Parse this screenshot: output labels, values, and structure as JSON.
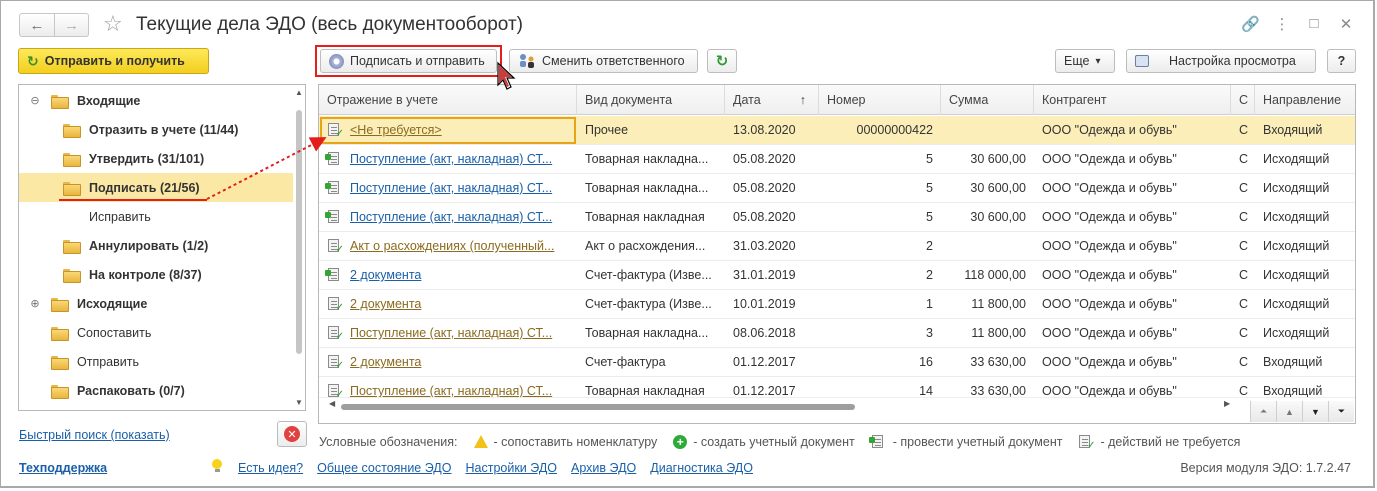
{
  "window": {
    "title": "Текущие дела ЭДО (весь документооборот)",
    "nav_back": "←",
    "nav_forward": "→",
    "star": "☆",
    "link_icon": "🔗",
    "menu_icon": "⋮",
    "maximize_icon": "□",
    "close_icon": "✕"
  },
  "left": {
    "send_button": "Отправить и получить",
    "tree": [
      {
        "label": "Входящие",
        "bold": true,
        "level": 0,
        "expander": "⊖",
        "folder": true
      },
      {
        "label": "Отразить в учете (11/44)",
        "bold": true,
        "level": 1,
        "folder": true
      },
      {
        "label": "Утвердить (31/101)",
        "bold": true,
        "level": 1,
        "folder": true
      },
      {
        "label": "Подписать (21/56)",
        "bold": true,
        "level": 1,
        "folder": true,
        "selected": true
      },
      {
        "label": "Исправить",
        "bold": false,
        "level": 1,
        "folder": false
      },
      {
        "label": "Аннулировать (1/2)",
        "bold": true,
        "level": 1,
        "folder": true
      },
      {
        "label": "На контроле (8/37)",
        "bold": true,
        "level": 1,
        "folder": true
      },
      {
        "label": "Исходящие",
        "bold": true,
        "level": 0,
        "expander": "⊕",
        "folder": true
      },
      {
        "label": "Сопоставить",
        "bold": false,
        "level": 0,
        "folder": true
      },
      {
        "label": "Отправить",
        "bold": false,
        "level": 0,
        "folder": true
      },
      {
        "label": "Распаковать (0/7)",
        "bold": true,
        "level": 0,
        "folder": true
      }
    ],
    "quick_search": "Быстрый поиск (показать)"
  },
  "toolbar": {
    "sign_send": "Подписать и отправить",
    "change_responsible": "Сменить ответственного",
    "refresh_icon": "↻",
    "more": "Еще",
    "more_arrow": "▾",
    "view_settings": "Настройка просмотра",
    "help": "?"
  },
  "table": {
    "columns": [
      "Отражение в учете",
      "Вид документа",
      "Дата",
      "Номер",
      "Сумма",
      "Контрагент",
      "С",
      "Направление"
    ],
    "sort_indicator": "↑",
    "rows": [
      {
        "account": "<Не требуется>",
        "link": "brown",
        "icon": "none",
        "doc": "Прочее",
        "date": "13.08.2020",
        "num": "00000000422",
        "sum": "",
        "party": "ООО \"Одежда и обувь\"",
        "s": "С",
        "dir": "Входящий",
        "selected": true
      },
      {
        "account": "Поступление (акт, накладная) СТ...",
        "link": "blue",
        "icon": "post",
        "doc": "Товарная накладна...",
        "date": "05.08.2020",
        "num": "5",
        "sum": "30 600,00",
        "party": "ООО \"Одежда и обувь\"",
        "s": "С",
        "dir": "Исходящий"
      },
      {
        "account": "Поступление (акт, накладная) СТ...",
        "link": "blue",
        "icon": "post",
        "doc": "Товарная накладна...",
        "date": "05.08.2020",
        "num": "5",
        "sum": "30 600,00",
        "party": "ООО \"Одежда и обувь\"",
        "s": "С",
        "dir": "Исходящий"
      },
      {
        "account": "Поступление (акт, накладная) СТ...",
        "link": "blue",
        "icon": "post",
        "doc": "Товарная накладная",
        "date": "05.08.2020",
        "num": "5",
        "sum": "30 600,00",
        "party": "ООО \"Одежда и обувь\"",
        "s": "С",
        "dir": "Исходящий"
      },
      {
        "account": "Акт о расхождениях (полученный...",
        "link": "brown",
        "icon": "none",
        "doc": "Акт о расхождения...",
        "date": "31.03.2020",
        "num": "2",
        "sum": "",
        "party": "ООО \"Одежда и обувь\"",
        "s": "С",
        "dir": "Исходящий"
      },
      {
        "account": "2 документа",
        "link": "blue",
        "icon": "post",
        "doc": "Счет-фактура (Изве...",
        "date": "31.01.2019",
        "num": "2",
        "sum": "118 000,00",
        "party": "ООО \"Одежда и обувь\"",
        "s": "С",
        "dir": "Исходящий"
      },
      {
        "account": "2 документа",
        "link": "brown",
        "icon": "none",
        "doc": "Счет-фактура (Изве...",
        "date": "10.01.2019",
        "num": "1",
        "sum": "11 800,00",
        "party": "ООО \"Одежда и обувь\"",
        "s": "С",
        "dir": "Исходящий"
      },
      {
        "account": "Поступление (акт, накладная) СТ...",
        "link": "brown",
        "icon": "none",
        "doc": "Товарная накладна...",
        "date": "08.06.2018",
        "num": "3",
        "sum": "11 800,00",
        "party": "ООО \"Одежда и обувь\"",
        "s": "С",
        "dir": "Исходящий"
      },
      {
        "account": "2 документа",
        "link": "brown",
        "icon": "none",
        "doc": "Счет-фактура",
        "date": "01.12.2017",
        "num": "16",
        "sum": "33 630,00",
        "party": "ООО \"Одежда и обувь\"",
        "s": "С",
        "dir": "Входящий"
      },
      {
        "account": "Поступление (акт, накладная) СТ...",
        "link": "brown",
        "icon": "none",
        "doc": "Товарная накладная",
        "date": "01.12.2017",
        "num": "14",
        "sum": "33 630,00",
        "party": "ООО \"Одежда и обувь\"",
        "s": "С",
        "dir": "Входящий"
      }
    ]
  },
  "legend": {
    "title": "Условные обозначения:",
    "items": [
      {
        "icon": "warning-icon",
        "text": "- сопоставить номенклатуру"
      },
      {
        "icon": "plus-icon",
        "text": "- создать учетный документ"
      },
      {
        "icon": "post-doc-icon",
        "text": "- провести учетный документ"
      },
      {
        "icon": "no-action-icon",
        "text": "- действий не требуется"
      }
    ]
  },
  "bottom": {
    "support": "Техподдержка",
    "links": [
      "Есть идея?",
      "Общее состояние ЭДО",
      "Настройки ЭДО",
      "Архив ЭДО",
      "Диагностика ЭДО"
    ],
    "version": "Версия модуля ЭДО: 1.7.2.47"
  },
  "colors": {
    "accent_yellow": "#f3cf1e",
    "selection": "#fbe8a4",
    "highlight_red": "#e41d1d",
    "link_blue": "#1a5fa8"
  }
}
